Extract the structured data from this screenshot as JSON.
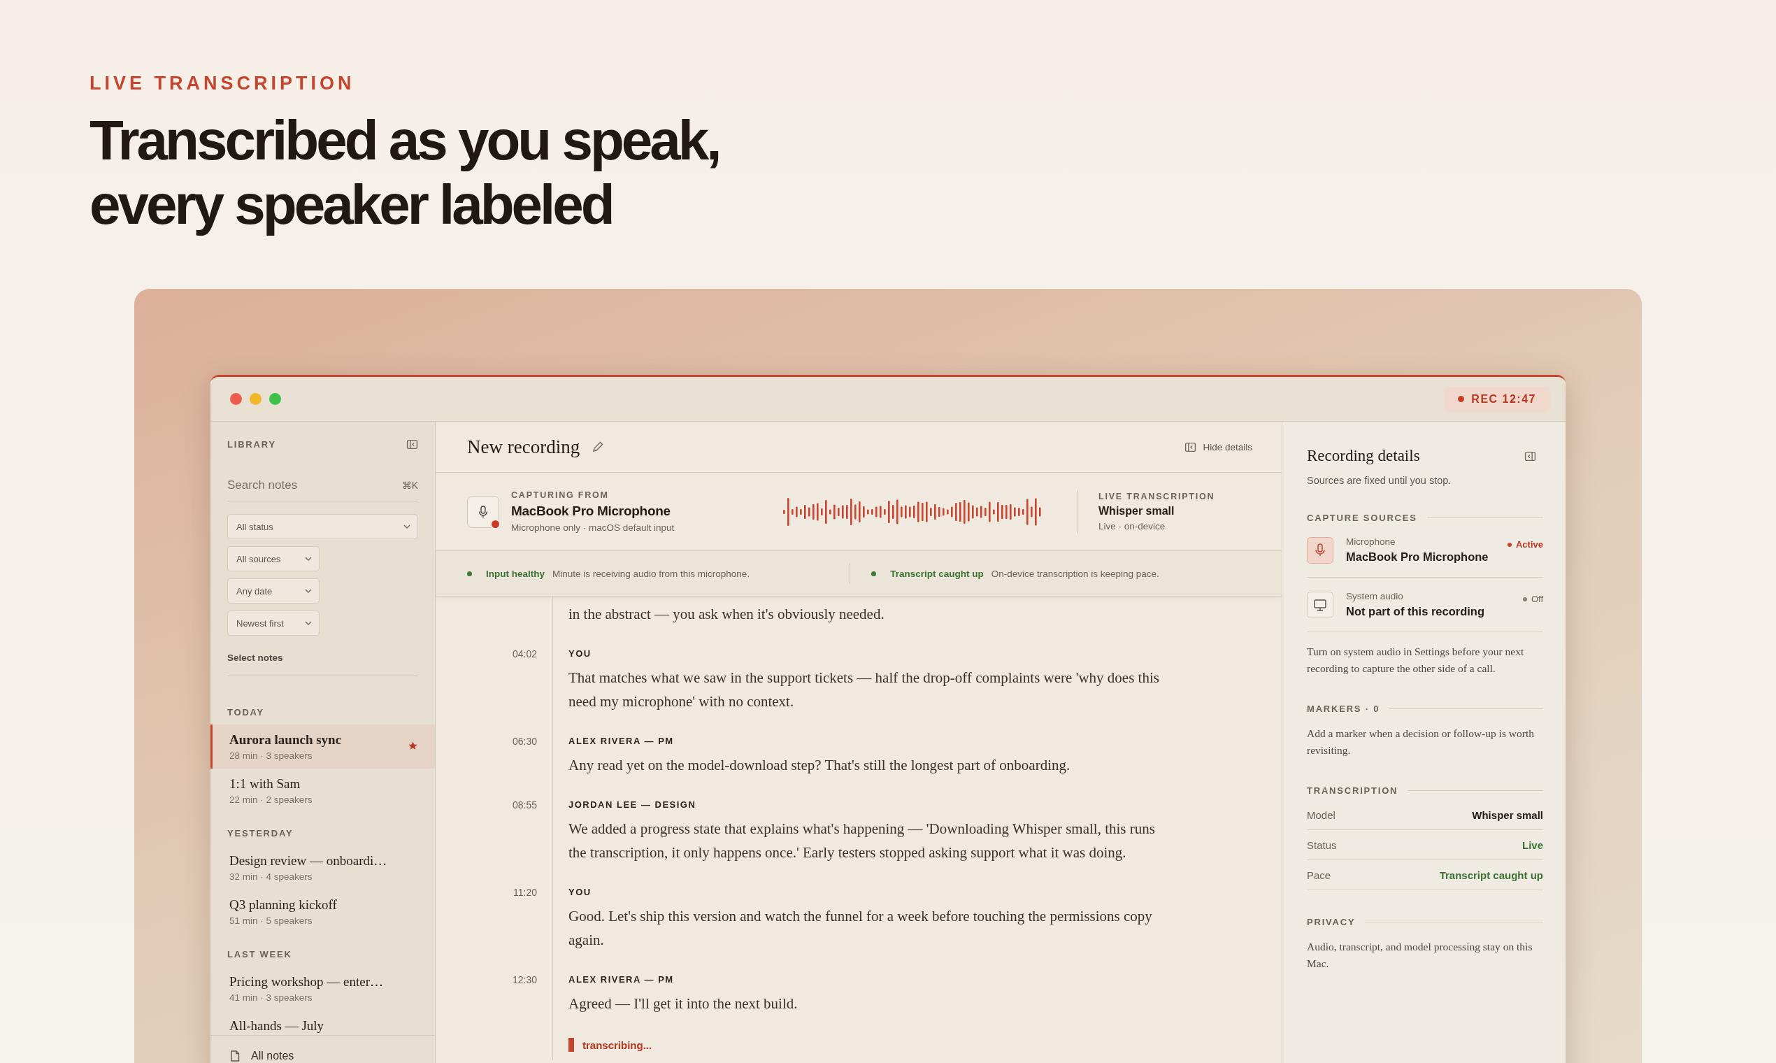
{
  "hero": {
    "eyebrow": "LIVE TRANSCRIPTION",
    "headline_lines": [
      "Transcribed as you speak,",
      "every speaker labeled"
    ]
  },
  "window": {
    "recording_badge": "REC 12:47"
  },
  "sidebar": {
    "title": "LIBRARY",
    "search": {
      "placeholder": "Search notes",
      "shortcut": "⌘K"
    },
    "filters": [
      {
        "value": "All status",
        "wide": true
      },
      {
        "value": "All sources",
        "wide": false
      },
      {
        "value": "Any date",
        "wide": false
      },
      {
        "value": "Newest first",
        "wide": false
      }
    ],
    "select_notes": "Select notes",
    "groups": [
      {
        "label": "TODAY",
        "items": [
          {
            "title": "Aurora launch sync",
            "meta": "28 min · 3 speakers",
            "selected": true,
            "starred": true
          },
          {
            "title": "1:1 with Sam",
            "meta": "22 min · 2 speakers",
            "selected": false,
            "starred": false
          }
        ]
      },
      {
        "label": "YESTERDAY",
        "items": [
          {
            "title": "Design review — onboardi…",
            "meta": "32 min · 4 speakers",
            "selected": false,
            "starred": false
          },
          {
            "title": "Q3 planning kickoff",
            "meta": "51 min · 5 speakers",
            "selected": false,
            "starred": false
          }
        ]
      },
      {
        "label": "LAST WEEK",
        "items": [
          {
            "title": "Pricing workshop — enter…",
            "meta": "41 min · 3 speakers",
            "selected": false,
            "starred": false
          },
          {
            "title": "All-hands — July",
            "selected": false,
            "starred": false
          }
        ]
      }
    ],
    "footer": "All notes"
  },
  "recording": {
    "title": "New recording",
    "hide_details": "Hide details",
    "capture": {
      "label": "CAPTURING FROM",
      "device": "MacBook Pro Microphone",
      "detail": "Microphone only · macOS default input"
    },
    "live": {
      "label": "LIVE TRANSCRIPTION",
      "model": "Whisper small",
      "detail": "Live · on-device"
    },
    "status": [
      {
        "label": "Input healthy",
        "text": "Minute is receiving audio from this microphone."
      },
      {
        "label": "Transcript caught up",
        "text": "On-device transcription is keeping pace."
      }
    ],
    "transcript": [
      {
        "text": "in the abstract — you ask when it's obviously needed."
      },
      {
        "time": "04:02",
        "speaker": "YOU",
        "text": "That matches what we saw in the support tickets — half the drop-off complaints were 'why does this need my microphone' with no context."
      },
      {
        "time": "06:30",
        "speaker": "ALEX RIVERA — PM",
        "text": "Any read yet on the model-download step? That's still the longest part of onboarding."
      },
      {
        "time": "08:55",
        "speaker": "JORDAN LEE — DESIGN",
        "text": "We added a progress state that explains what's happening — 'Downloading Whisper small, this runs the transcription, it only happens once.' Early testers stopped asking support what it was doing."
      },
      {
        "time": "11:20",
        "speaker": "YOU",
        "text": "Good. Let's ship this version and watch the funnel for a week before touching the permissions copy again."
      },
      {
        "time": "12:30",
        "speaker": "ALEX RIVERA — PM",
        "text": "Agreed — I'll get it into the next build."
      }
    ],
    "transcribing": "transcribing..."
  },
  "details": {
    "title": "Recording details",
    "subtitle": "Sources are fixed until you stop.",
    "sections": [
      {
        "kind": "sources",
        "heading": "CAPTURE SOURCES",
        "sources": [
          {
            "kind": "microphone",
            "label": "Microphone",
            "value": "MacBook Pro Microphone",
            "status": "Active",
            "active": true
          },
          {
            "kind": "system",
            "label": "System audio",
            "value": "Not part of this recording",
            "status": "Off",
            "active": false
          }
        ],
        "note": "Turn on system audio in Settings before your next recording to capture the other side of a call."
      },
      {
        "kind": "note",
        "heading": "MARKERS · 0",
        "note": "Add a marker when a decision or follow-up is worth revisiting."
      },
      {
        "kind": "rows",
        "heading": "TRANSCRIPTION",
        "rows": [
          {
            "label": "Model",
            "value": "Whisper small",
            "positive": false
          },
          {
            "label": "Status",
            "value": "Live",
            "positive": true
          },
          {
            "label": "Pace",
            "value": "Transcript caught up",
            "positive": true
          }
        ]
      },
      {
        "kind": "note",
        "heading": "PRIVACY",
        "note": "Audio, transcript, and model processing stay on this Mac."
      }
    ]
  }
}
